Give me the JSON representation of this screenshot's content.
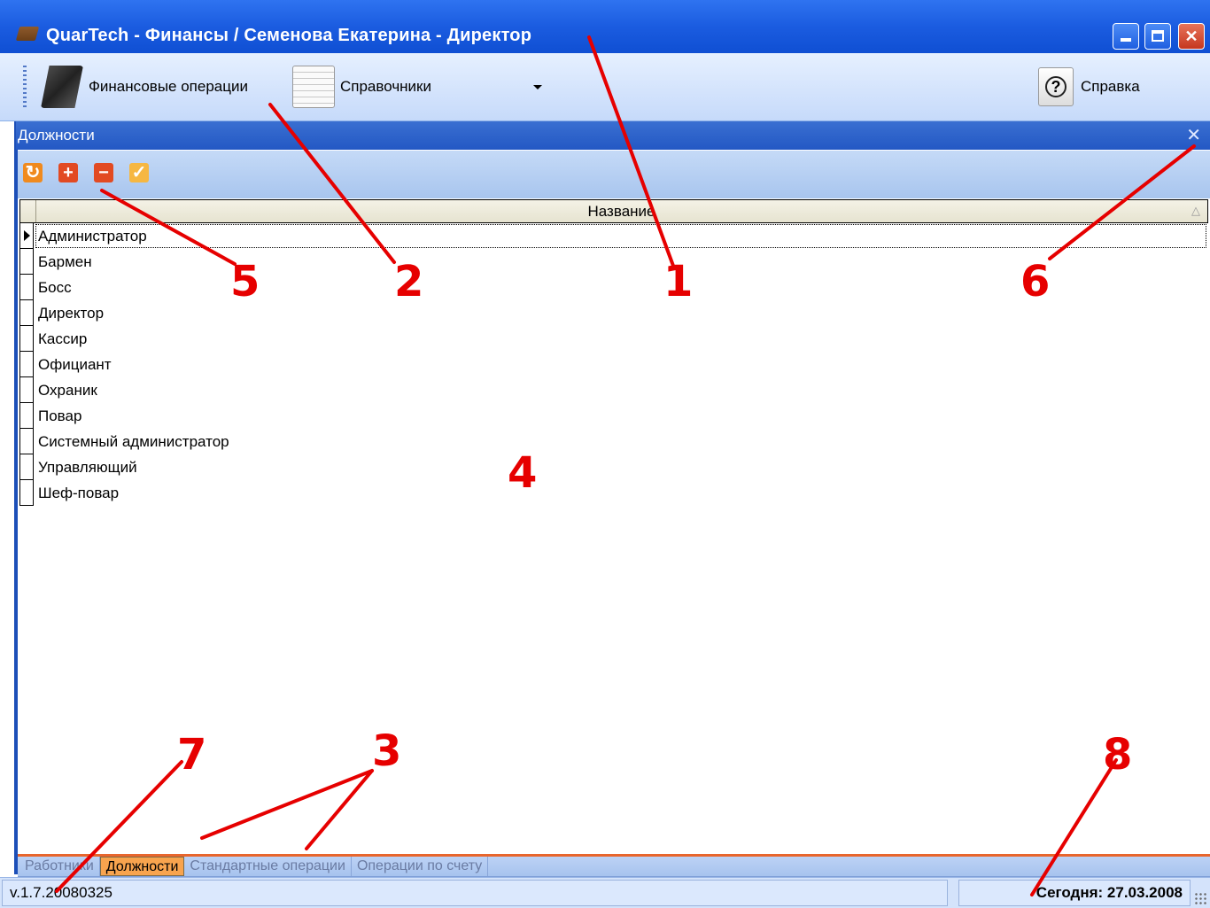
{
  "window": {
    "title": "QuarTech - Финансы / Семенова Екатерина - Директор",
    "minimize_label": "minimize",
    "maximize_label": "maximize",
    "close_label": "✕"
  },
  "toolbar": {
    "financial_ops": "Финансовые операции",
    "references": "Справочники",
    "help": "Справка"
  },
  "panel": {
    "title": "Должности",
    "close_label": "✕"
  },
  "actions": {
    "refresh": "↻",
    "add": "+",
    "remove": "−",
    "check": "✓"
  },
  "grid": {
    "column_header": "Название",
    "sort_glyph": "△",
    "rows": [
      "Администратор",
      "Бармен",
      "Босс",
      "Директор",
      "Кассир",
      "Официант",
      "Охраник",
      "Повар",
      "Системный администратор",
      "Управляющий",
      "Шеф-повар"
    ],
    "selected_index": 0
  },
  "tabs": [
    "Работники",
    "Должности",
    "Стандартные операции",
    "Операции по счету"
  ],
  "active_tab": 1,
  "status": {
    "version": "v.1.7.20080325",
    "date": "Сегодня: 27.03.2008"
  },
  "annotations": [
    "1",
    "2",
    "3",
    "4",
    "5",
    "6",
    "7",
    "8"
  ],
  "colors": {
    "title_bar": "#1b5ce0",
    "panel_header": "#2358c4",
    "active_tab": "#f8a44e",
    "annotation": "#e60000",
    "action_orange": "#f08a1e",
    "action_red": "#e24a22"
  }
}
